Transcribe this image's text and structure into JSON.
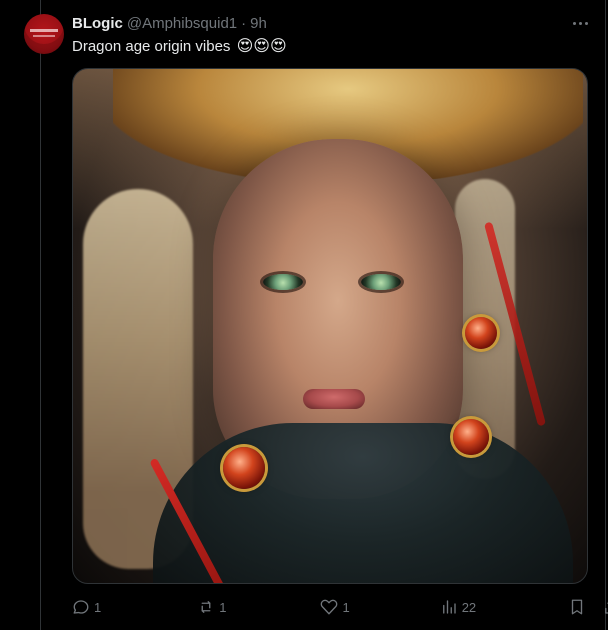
{
  "tweet": {
    "author": {
      "display_name": "BLogic",
      "handle": "@Amphibsquid1",
      "separator": "·",
      "time": "9h"
    },
    "text": "Dragon age origin vibes",
    "emojis": "😍😍😍",
    "media": {
      "type": "image",
      "subject": "fantasy portrait"
    },
    "actions": {
      "reply_count": "1",
      "retweet_count": "1",
      "like_count": "1",
      "views_count": "22"
    },
    "icons": {
      "more": "more-dots-icon",
      "reply": "reply-icon",
      "retweet": "retweet-icon",
      "like": "heart-icon",
      "views": "views-icon",
      "bookmark": "bookmark-icon",
      "share": "share-icon"
    }
  },
  "colors": {
    "background": "#000000",
    "text_primary": "#e7e9ea",
    "text_secondary": "#71767b",
    "border": "#2f3336"
  }
}
